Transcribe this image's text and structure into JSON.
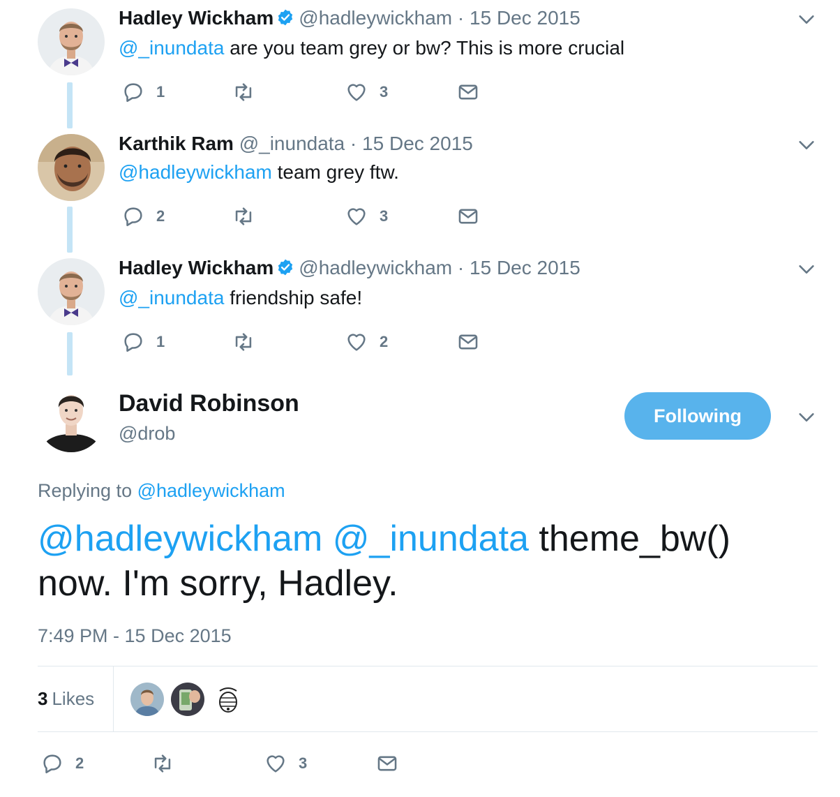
{
  "colors": {
    "link": "#1da1f2",
    "muted": "#657786",
    "thread_line": "#c4e4f6",
    "follow_button": "#58b3ec"
  },
  "replies": [
    {
      "name": "Hadley Wickham",
      "verified": true,
      "handle": "@hadleywickham",
      "date": "15 Dec 2015",
      "mention": "@_inundata",
      "text": " are you team grey or bw? This is more crucial",
      "reply_count": "1",
      "like_count": "3"
    },
    {
      "name": "Karthik Ram",
      "verified": false,
      "handle": "@_inundata",
      "date": "15 Dec 2015",
      "mention": "@hadleywickham",
      "text": " team grey ftw.",
      "reply_count": "2",
      "like_count": "3"
    },
    {
      "name": "Hadley Wickham",
      "verified": true,
      "handle": "@hadleywickham",
      "date": "15 Dec 2015",
      "mention": "@_inundata",
      "text": " friendship safe!",
      "reply_count": "1",
      "like_count": "2"
    }
  ],
  "main_tweet": {
    "name": "David Robinson",
    "handle": "@drob",
    "follow_label": "Following",
    "replying_prefix": "Replying to ",
    "replying_to": "@hadleywickham",
    "mention1": "@hadleywickham",
    "mention2": "@_inundata",
    "text": " theme_bw() now. I'm sorry, Hadley.",
    "timestamp": "7:49 PM - 15 Dec 2015",
    "likes_count": "3",
    "likes_label": "Likes",
    "reply_count": "2",
    "like_count": "3"
  },
  "icons": [
    "reply-icon",
    "retweet-icon",
    "like-icon",
    "message-icon",
    "verified-icon",
    "caret-down-icon"
  ]
}
